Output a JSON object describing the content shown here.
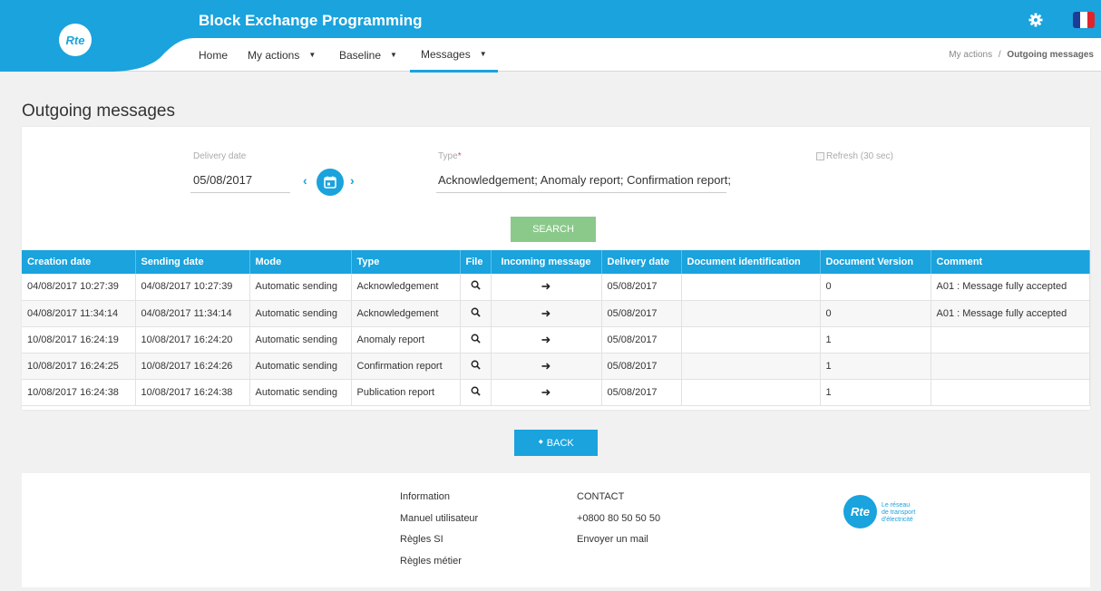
{
  "header": {
    "logo_text": "Rte",
    "app_title": "Block Exchange Programming",
    "icons": [
      "gear-icon",
      "flag-fr-icon"
    ],
    "flag_colors": [
      "#1c3c96",
      "#ffffff",
      "#e0242c"
    ],
    "accent_color": "#1aa3dd"
  },
  "nav": {
    "home": "Home",
    "my_actions": "My actions",
    "baseline": "Baseline",
    "messages": "Messages"
  },
  "breadcrumb": {
    "parent": "My actions",
    "separator": "/",
    "current": "Outgoing messages"
  },
  "page": {
    "title": "Outgoing messages"
  },
  "filters": {
    "delivery_date_label": "Delivery date",
    "delivery_date_value": "05/08/2017",
    "type_label": "Type",
    "type_required": "*",
    "type_value": "Acknowledgement; Anomaly report; Confirmation report;",
    "refresh_label": "Refresh (30 sec)",
    "search_label": "SEARCH"
  },
  "table": {
    "columns": [
      "Creation date",
      "Sending date",
      "Mode",
      "Type",
      "File",
      "Incoming message",
      "Delivery date",
      "Document identification",
      "Document Version",
      "Comment"
    ],
    "rows": [
      [
        "04/08/2017 10:27:39",
        "04/08/2017 10:27:39",
        "Automatic sending",
        "Acknowledgement",
        "",
        "",
        "05/08/2017",
        "",
        "0",
        "A01 : Message fully accepted"
      ],
      [
        "04/08/2017 11:34:14",
        "04/08/2017 11:34:14",
        "Automatic sending",
        "Acknowledgement",
        "",
        "",
        "05/08/2017",
        "",
        "0",
        "A01 : Message fully accepted"
      ],
      [
        "10/08/2017 16:24:19",
        "10/08/2017 16:24:20",
        "Automatic sending",
        "Anomaly report",
        "",
        "",
        "05/08/2017",
        "",
        "1",
        ""
      ],
      [
        "10/08/2017 16:24:25",
        "10/08/2017 16:24:26",
        "Automatic sending",
        "Confirmation report",
        "",
        "",
        "05/08/2017",
        "",
        "1",
        ""
      ],
      [
        "10/08/2017 16:24:38",
        "10/08/2017 16:24:38",
        "Automatic sending",
        "Publication report",
        "",
        "",
        "05/08/2017",
        "",
        "1",
        ""
      ]
    ],
    "arrow_glyph": "➜"
  },
  "back_label": "BACK",
  "footer": {
    "information": "Information",
    "manual": "Manuel utilisateur",
    "regles_si": "Règles SI",
    "regles_metier": "Règles métier",
    "contact": "CONTACT",
    "phone": "+0800 80 50 50 50",
    "mail": "Envoyer un mail",
    "logo_text": "Rte",
    "tagline_1": "Le réseau",
    "tagline_2": "de transport",
    "tagline_3": "d'électricité"
  }
}
